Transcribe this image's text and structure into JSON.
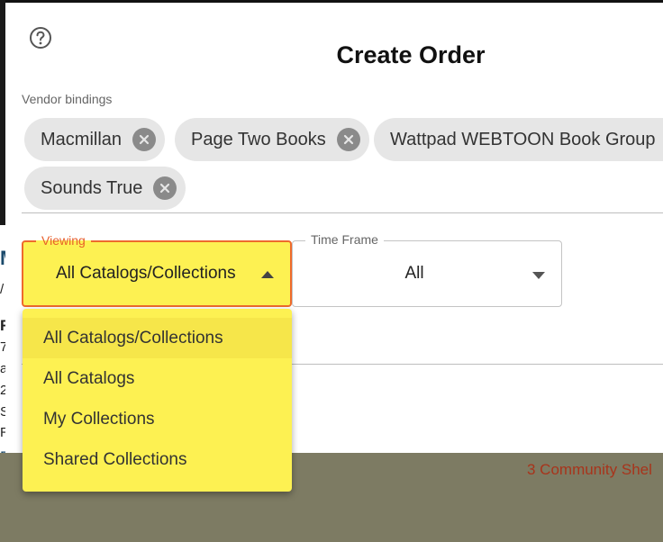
{
  "background": {
    "fragments": [
      "M",
      "/",
      "R",
      "7",
      "a",
      "2",
      "S",
      "R",
      "Re",
      "B/",
      "3 Community Shel"
    ]
  },
  "modal": {
    "title": "Create Order",
    "help_icon": "question-circle-icon",
    "vendor_bindings": {
      "label": "Vendor bindings",
      "chips": [
        "Macmillan",
        "Page Two Books",
        "Wattpad WEBTOON Book Group",
        "Sounds True"
      ]
    },
    "viewing": {
      "label": "Viewing",
      "value": "All Catalogs/Collections",
      "options": [
        "All Catalogs/Collections",
        "All Catalogs",
        "My Collections",
        "Shared Collections"
      ],
      "selected_index": 0
    },
    "time_frame": {
      "label": "Time Frame",
      "value": "All"
    }
  },
  "colors": {
    "accent": "#ee6a2c",
    "highlight": "#fdf152",
    "chip_bg": "#e6e6e6"
  }
}
